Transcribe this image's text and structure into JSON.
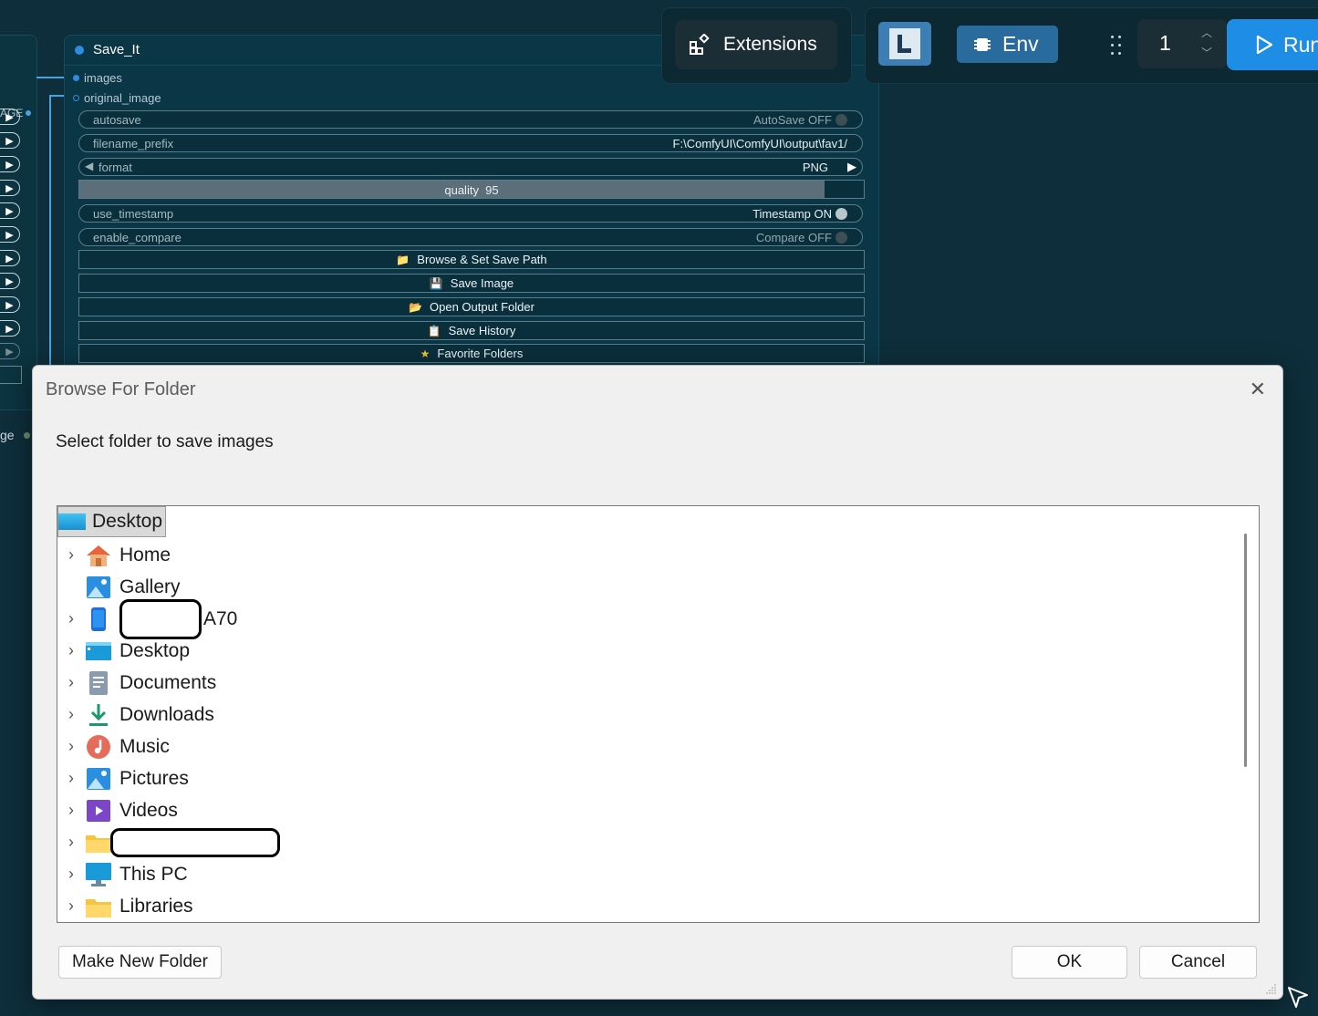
{
  "toolbar": {
    "extensions_label": "Extensions",
    "env_label": "Env",
    "batch_count": "1",
    "run_label": "Run"
  },
  "left_node": {
    "output_label": "AGE",
    "bottom_label": "ge"
  },
  "node": {
    "title": "Save_It",
    "inputs": [
      "images",
      "original_image"
    ],
    "widgets": {
      "autosave": {
        "label": "autosave",
        "value": "AutoSave OFF"
      },
      "filename_prefix": {
        "label": "filename_prefix",
        "value": "F:\\ComfyUI\\ComfyUI\\output\\fav1/"
      },
      "format": {
        "label": "format",
        "value": "PNG"
      },
      "quality": {
        "label": "quality",
        "value": "95",
        "fraction": 0.95
      },
      "use_timestamp": {
        "label": "use_timestamp",
        "value": "Timestamp ON"
      },
      "enable_compare": {
        "label": "enable_compare",
        "value": "Compare OFF"
      }
    },
    "buttons": {
      "browse": "Browse & Set Save Path",
      "save": "Save Image",
      "open_output": "Open Output Folder",
      "history": "Save History",
      "favorites": "Favorite Folders"
    }
  },
  "dialog": {
    "title": "Browse For Folder",
    "description": "Select folder to save images",
    "root": "Desktop",
    "items": [
      {
        "label": "Home",
        "icon": "home-icon",
        "expandable": true
      },
      {
        "label": "Gallery",
        "icon": "gallery-icon",
        "expandable": false
      },
      {
        "label": "A70",
        "icon": "phone-icon",
        "expandable": true,
        "redacted_prefix": true
      },
      {
        "label": "Desktop",
        "icon": "desktop-icon",
        "expandable": true
      },
      {
        "label": "Documents",
        "icon": "documents-icon",
        "expandable": true
      },
      {
        "label": "Downloads",
        "icon": "downloads-icon",
        "expandable": true
      },
      {
        "label": "Music",
        "icon": "music-icon",
        "expandable": true
      },
      {
        "label": "Pictures",
        "icon": "pictures-icon",
        "expandable": true
      },
      {
        "label": "Videos",
        "icon": "videos-icon",
        "expandable": true
      },
      {
        "label": "",
        "icon": "folder-icon",
        "expandable": true,
        "redacted": true
      },
      {
        "label": "This PC",
        "icon": "this-pc-icon",
        "expandable": true
      },
      {
        "label": "Libraries",
        "icon": "libraries-icon",
        "expandable": true
      }
    ],
    "make_new_folder": "Make New Folder",
    "ok": "OK",
    "cancel": "Cancel"
  },
  "colors": {
    "canvas_bg": "#0e2e3b",
    "node_bg": "#0b3645",
    "accent_blue": "#2f8be0",
    "run_blue": "#1e8de6",
    "env_blue": "#2a6b9e"
  }
}
